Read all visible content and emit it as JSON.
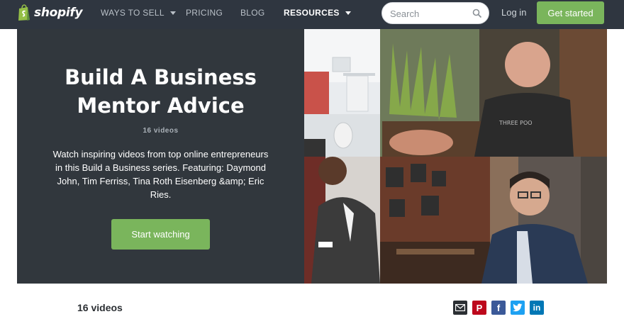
{
  "nav": {
    "logo_text": "shopify",
    "items": [
      {
        "label": "WAYS TO SELL",
        "has_dropdown": true
      },
      {
        "label": "PRICING",
        "has_dropdown": false
      },
      {
        "label": "BLOG",
        "has_dropdown": false
      },
      {
        "label": "RESOURCES",
        "has_dropdown": true
      }
    ],
    "search_placeholder": "Search",
    "login_label": "Log in",
    "cta_label": "Get started"
  },
  "hero": {
    "title_line1": "Build A Business",
    "title_line2": "Mentor Advice",
    "video_count": "16 videos",
    "description": "Watch inspiring videos from top online entrepreneurs in this Build a Business series. Featuring: Daymond John, Tim Ferriss, Tina Roth Eisenberg &amp; Eric Ries.",
    "button_label": "Start watching"
  },
  "section": {
    "video_count": "16 videos"
  },
  "share_icons": [
    "email-icon",
    "pinterest-icon",
    "facebook-icon",
    "twitter-icon",
    "linkedin-icon"
  ],
  "colors": {
    "nav_bg": "#2f3640",
    "hero_bg": "#31373d",
    "accent_green": "#7ab55c",
    "pinterest": "#bd081c",
    "facebook": "#3b5998",
    "twitter": "#1da1f2",
    "linkedin": "#0077b5",
    "email": "#2b2f33"
  }
}
